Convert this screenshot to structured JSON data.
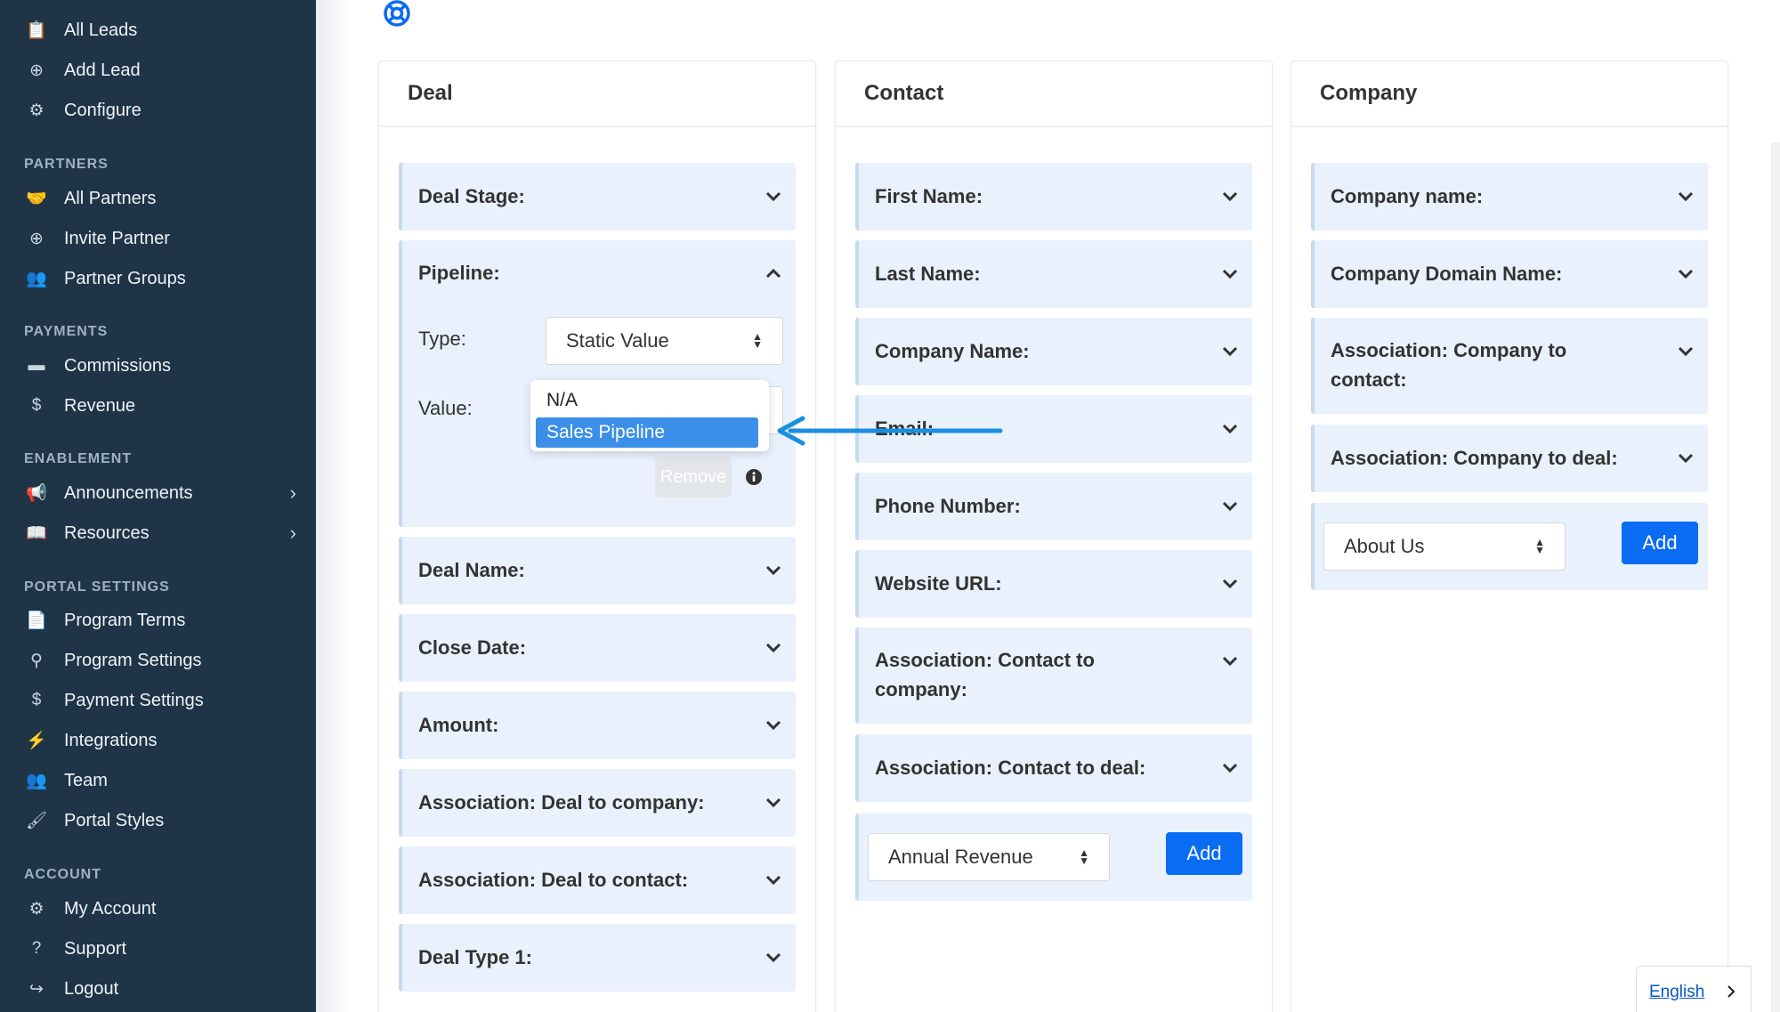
{
  "sidebar": {
    "sections": {
      "partners": "PARTNERS",
      "payments": "PAYMENTS",
      "enablement": "ENABLEMENT",
      "portal_settings": "PORTAL SETTINGS",
      "account": "ACCOUNT"
    },
    "items": {
      "all_leads": "All Leads",
      "add_lead": "Add Lead",
      "configure": "Configure",
      "all_partners": "All Partners",
      "invite_partner": "Invite Partner",
      "partner_groups": "Partner Groups",
      "commissions": "Commissions",
      "revenue": "Revenue",
      "announcements": "Announcements",
      "resources": "Resources",
      "program_terms": "Program Terms",
      "program_settings": "Program Settings",
      "payment_settings": "Payment Settings",
      "integrations": "Integrations",
      "team": "Team",
      "portal_styles": "Portal Styles",
      "my_account": "My Account",
      "support": "Support",
      "logout": "Logout"
    }
  },
  "deal": {
    "title": "Deal",
    "deal_stage": "Deal Stage:",
    "pipeline": "Pipeline:",
    "type_label": "Type:",
    "type_value": "Static Value",
    "value_label": "Value:",
    "dropdown_options": [
      "N/A",
      "Sales Pipeline"
    ],
    "remove": "Remove",
    "deal_name": "Deal Name:",
    "close_date": "Close Date:",
    "amount": "Amount:",
    "assoc_company": "Association: Deal to company:",
    "assoc_contact": "Association: Deal to contact:",
    "deal_type": "Deal Type 1:"
  },
  "contact": {
    "title": "Contact",
    "first_name": "First Name:",
    "last_name": "Last Name:",
    "company_name": "Company Name:",
    "email": "Email:",
    "phone": "Phone Number:",
    "website": "Website URL:",
    "assoc_company_1": "Association: Contact to",
    "assoc_company_2": "company:",
    "assoc_deal": "Association: Contact to deal:",
    "select_value": "Annual Revenue",
    "add": "Add"
  },
  "company": {
    "title": "Company",
    "company_name": "Company name:",
    "domain": "Company Domain Name:",
    "assoc_contact_1": "Association: Company to",
    "assoc_contact_2": "contact:",
    "assoc_deal": "Association: Company to deal:",
    "select_value": "About Us",
    "add": "Add"
  },
  "language": "English",
  "colors": {
    "sidebar_bg": "#1f3447",
    "accent": "#0a6cf2",
    "panel_bg": "#e8f1fc",
    "annotation_arrow": "#1a8fe0"
  }
}
